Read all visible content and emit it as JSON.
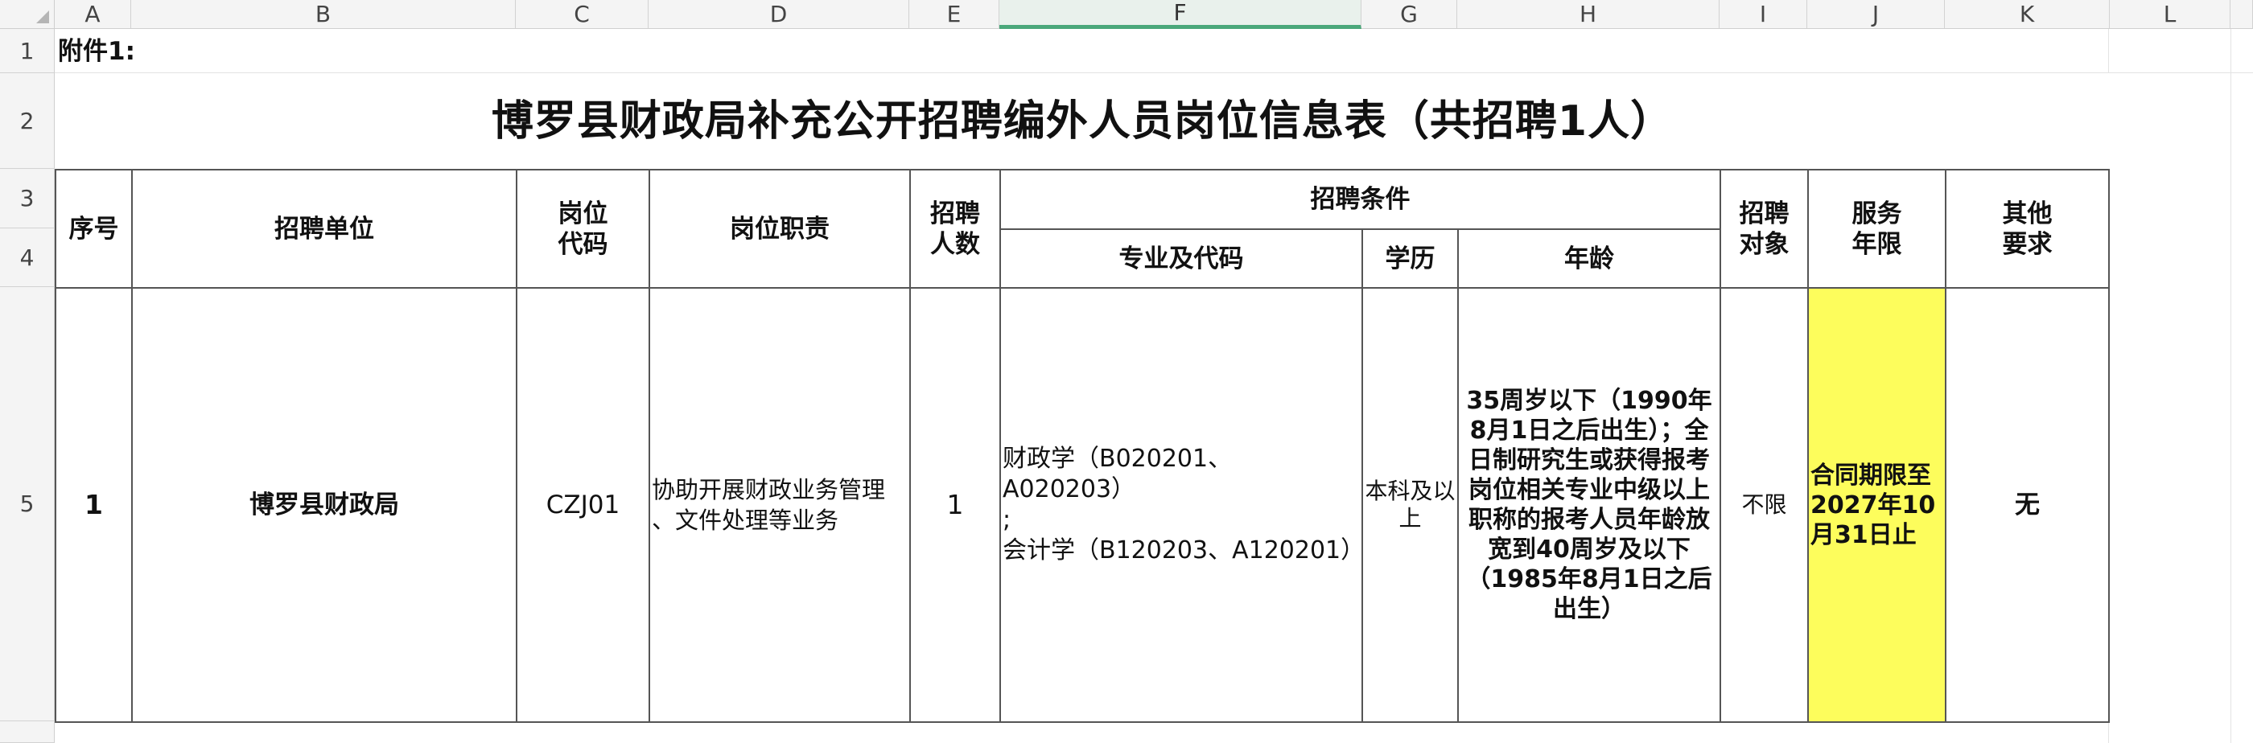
{
  "sheet": {
    "column_headers": [
      "A",
      "B",
      "C",
      "D",
      "E",
      "F",
      "G",
      "H",
      "I",
      "J",
      "K",
      "L"
    ],
    "row_headers": [
      "1",
      "2",
      "3",
      "4",
      "5"
    ],
    "selected_column": "F"
  },
  "table": {
    "attachment_label": "附件1:",
    "title": "博罗县财政局补充公开招聘编外人员岗位信息表（共招聘1人）",
    "headers": {
      "seq": "序号",
      "unit": "招聘单位",
      "post_code": "岗位\n代码",
      "duty": "岗位职责",
      "count": "招聘\n人数",
      "conditions": "招聘条件",
      "major": "专业及代码",
      "education": "学历",
      "age": "年龄",
      "target": "招聘\n对象",
      "service": "服务\n年限",
      "other": "其他\n要求"
    },
    "row": {
      "seq": "1",
      "unit": "博罗县财政局",
      "post_code": "CZJ01",
      "duty": "协助开展财政业务管理\n、文件处理等业务",
      "count": "1",
      "major": "财政学（B020201、A020203）\n;\n会计学（B120203、A120201）",
      "education": "本科及以\n上",
      "age": "35周岁以下（1990年8月1日之后出生）；全日制研究生或获得报考岗位相关专业中级以上职称的报考人员年龄放宽到40周岁及以下（1985年8月1日之后出生）",
      "target": "不限",
      "service": "合同期限至2027年10月31日止",
      "other": "无"
    }
  }
}
